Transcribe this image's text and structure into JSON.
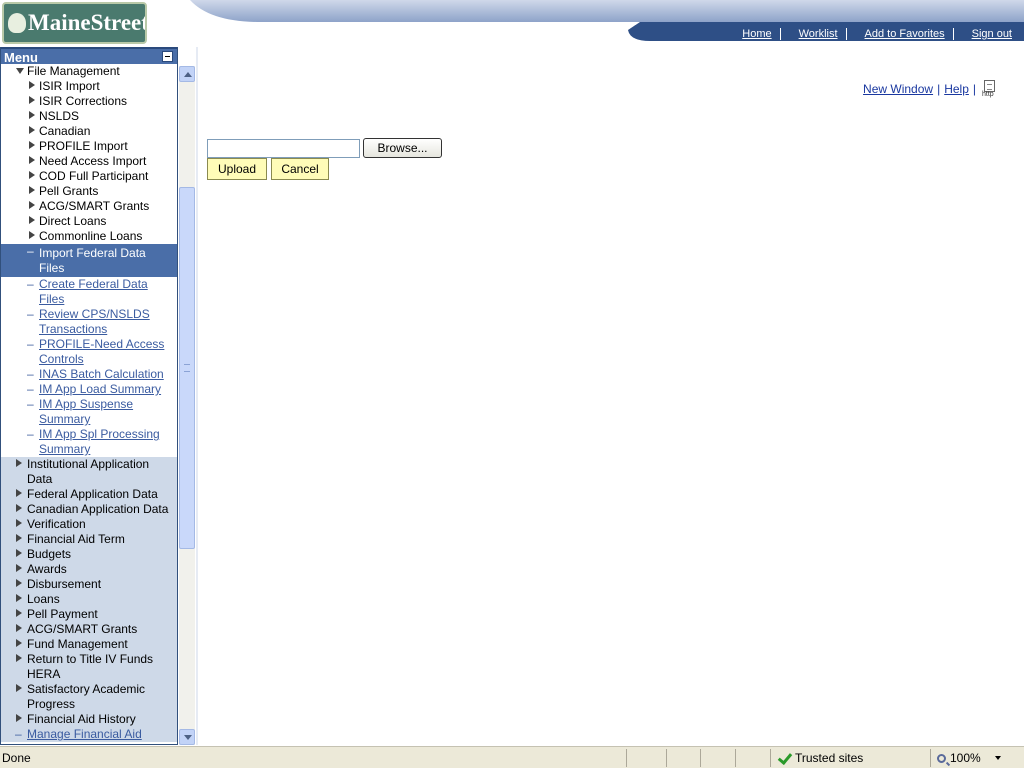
{
  "header": {
    "logo_text": "MaineStreet",
    "nav": [
      "Home",
      "Worklist",
      "Add to Favorites",
      "Sign out"
    ]
  },
  "menu": {
    "title": "Menu",
    "items": [
      {
        "label": "File Management",
        "level": 1,
        "type": "expanded"
      },
      {
        "label": "ISIR Import",
        "level": 2,
        "type": "folder"
      },
      {
        "label": "ISIR Corrections",
        "level": 2,
        "type": "folder"
      },
      {
        "label": "NSLDS",
        "level": 2,
        "type": "folder"
      },
      {
        "label": "Canadian",
        "level": 2,
        "type": "folder"
      },
      {
        "label": "PROFILE Import",
        "level": 2,
        "type": "folder"
      },
      {
        "label": "Need Access Import",
        "level": 2,
        "type": "folder"
      },
      {
        "label": "COD Full Participant",
        "level": 2,
        "type": "folder"
      },
      {
        "label": "Pell Grants",
        "level": 2,
        "type": "folder"
      },
      {
        "label": "ACG/SMART Grants",
        "level": 2,
        "type": "folder"
      },
      {
        "label": "Direct Loans",
        "level": 2,
        "type": "folder"
      },
      {
        "label": "Commonline Loans",
        "level": 2,
        "type": "folder"
      },
      {
        "label": "Import Federal Data Files",
        "level": 2,
        "type": "selected"
      },
      {
        "label": "Create Federal Data Files",
        "level": 2,
        "type": "link"
      },
      {
        "label": "Review CPS/NSLDS Transactions",
        "level": 2,
        "type": "link"
      },
      {
        "label": "PROFILE-Need Access Controls",
        "level": 2,
        "type": "link"
      },
      {
        "label": "INAS Batch Calculation",
        "level": 2,
        "type": "link"
      },
      {
        "label": "IM App Load Summary",
        "level": 2,
        "type": "link"
      },
      {
        "label": "IM App Suspense Summary",
        "level": 2,
        "type": "link"
      },
      {
        "label": "IM App Spl Processing Summary",
        "level": 2,
        "type": "link"
      },
      {
        "label": "Institutional Application Data",
        "level": 1,
        "type": "folder-grey"
      },
      {
        "label": "Federal Application Data",
        "level": 1,
        "type": "folder-grey"
      },
      {
        "label": "Canadian Application Data",
        "level": 1,
        "type": "folder-grey"
      },
      {
        "label": "Verification",
        "level": 1,
        "type": "folder-grey"
      },
      {
        "label": "Financial Aid Term",
        "level": 1,
        "type": "folder-grey"
      },
      {
        "label": "Budgets",
        "level": 1,
        "type": "folder-grey"
      },
      {
        "label": "Awards",
        "level": 1,
        "type": "folder-grey"
      },
      {
        "label": "Disbursement",
        "level": 1,
        "type": "folder-grey"
      },
      {
        "label": "Loans",
        "level": 1,
        "type": "folder-grey"
      },
      {
        "label": "Pell Payment",
        "level": 1,
        "type": "folder-grey"
      },
      {
        "label": "ACG/SMART Grants",
        "level": 1,
        "type": "folder-grey"
      },
      {
        "label": "Fund Management",
        "level": 1,
        "type": "folder-grey"
      },
      {
        "label": "Return to Title IV Funds HERA",
        "level": 1,
        "type": "folder-grey"
      },
      {
        "label": "Satisfactory Academic Progress",
        "level": 1,
        "type": "folder-grey"
      },
      {
        "label": "Financial Aid History",
        "level": 1,
        "type": "folder-grey"
      },
      {
        "label": "Manage Financial Aid",
        "level": 1,
        "type": "link-grey"
      }
    ]
  },
  "main": {
    "new_window": "New Window",
    "help": "Help",
    "http_icon_label": "http",
    "file_input_value": "",
    "browse_label": "Browse...",
    "upload_label": "Upload",
    "cancel_label": "Cancel"
  },
  "statusbar": {
    "status": "Done",
    "zone": "Trusted sites",
    "zoom": "100%"
  }
}
